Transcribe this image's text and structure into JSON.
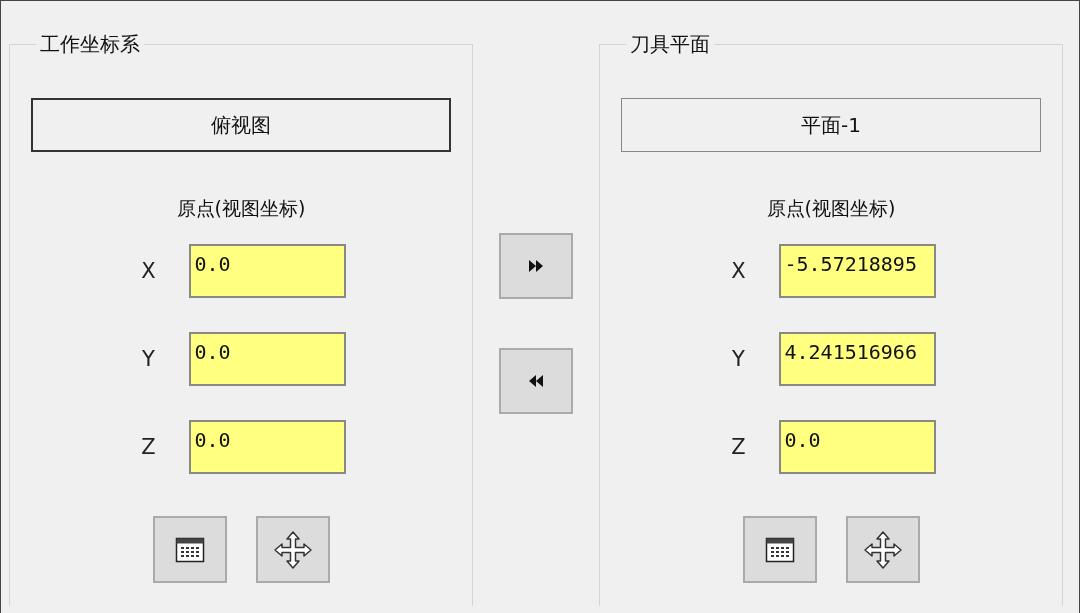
{
  "panels": [
    {
      "title": "工作坐标系",
      "view_button": {
        "label": "俯视图",
        "selected": true
      },
      "origin_label": "原点(视图坐标)",
      "coords": [
        {
          "axis": "X",
          "value": "0.0"
        },
        {
          "axis": "Y",
          "value": "0.0"
        },
        {
          "axis": "Z",
          "value": "0.0"
        }
      ]
    },
    {
      "title": "刀具平面",
      "view_button": {
        "label": "平面-1",
        "selected": false
      },
      "origin_label": "原点(视图坐标)",
      "coords": [
        {
          "axis": "X",
          "value": "-5.57218895"
        },
        {
          "axis": "Y",
          "value": "4.241516966"
        },
        {
          "axis": "Z",
          "value": "0.0"
        }
      ]
    }
  ]
}
